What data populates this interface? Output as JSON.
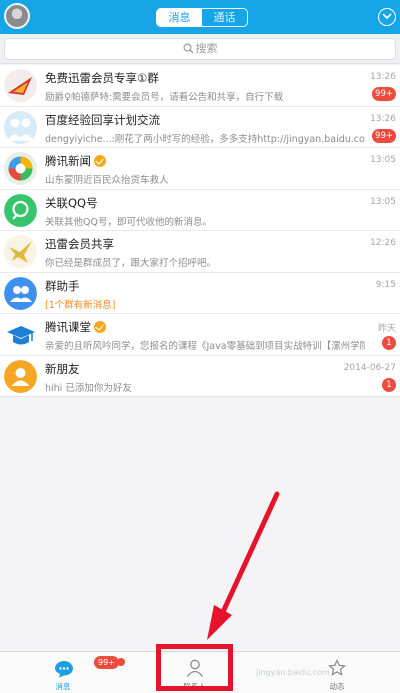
{
  "header": {
    "tabs": [
      {
        "label": "消息"
      },
      {
        "label": "通话"
      }
    ]
  },
  "search": {
    "placeholder": "搜索"
  },
  "conversations": [
    {
      "title": "免费迅雷会员专享①群",
      "preview": "励爵♀帕德萨特:需要会员号，请看公告和共享，自行下载",
      "time": "13:26",
      "badge": "99+",
      "avatar": "xunlei-group-avatar"
    },
    {
      "title": "百度经验回享计划交流",
      "preview": "dengyiyiche...:刚花了两小时写的经验，多多支持http://jingyan.baidu.com/...",
      "time": "13:26",
      "badge": "99+",
      "avatar": "baidu-group-avatar"
    },
    {
      "title": "腾讯新闻",
      "preview": "山东蒙阴近百民众抬货车救人",
      "time": "13:05",
      "badge": "",
      "avatar": "tencent-news-avatar"
    },
    {
      "title": "关联QQ号",
      "preview": "关联其他QQ号，即可代收他的新消息。",
      "time": "13:05",
      "badge": "",
      "avatar": "link-qq-avatar"
    },
    {
      "title": "迅雷会员共享",
      "preview": "你已经是群成员了，跟大家打个招呼吧。",
      "time": "12:26",
      "badge": "",
      "avatar": "xunlei-share-avatar"
    },
    {
      "title": "群助手",
      "preview": "[1个群有新消息]",
      "time": "9:15",
      "badge": "",
      "avatar": "group-helper-avatar"
    },
    {
      "title": "腾讯课堂",
      "preview": "亲爱的且听风吟同学，您报名的课程《Java零基础到项目实战特训【漯州学院...",
      "time": "昨天",
      "badge": "1",
      "avatar": "tencent-classroom-avatar"
    },
    {
      "title": "新朋友",
      "preview": "hihi 已添加你为好友",
      "time": "2014-06-27",
      "badge": "1",
      "avatar": "new-friend-avatar"
    }
  ],
  "tabbar": {
    "messages": "消息",
    "messages_badge": "99+",
    "contacts": "联系人",
    "dynamics": "动态"
  },
  "watermark": "jingyan.baidu.com",
  "colors": {
    "accent": "#16a6e8",
    "badge": "#ef4b3d",
    "highlight": "#e5142b"
  }
}
